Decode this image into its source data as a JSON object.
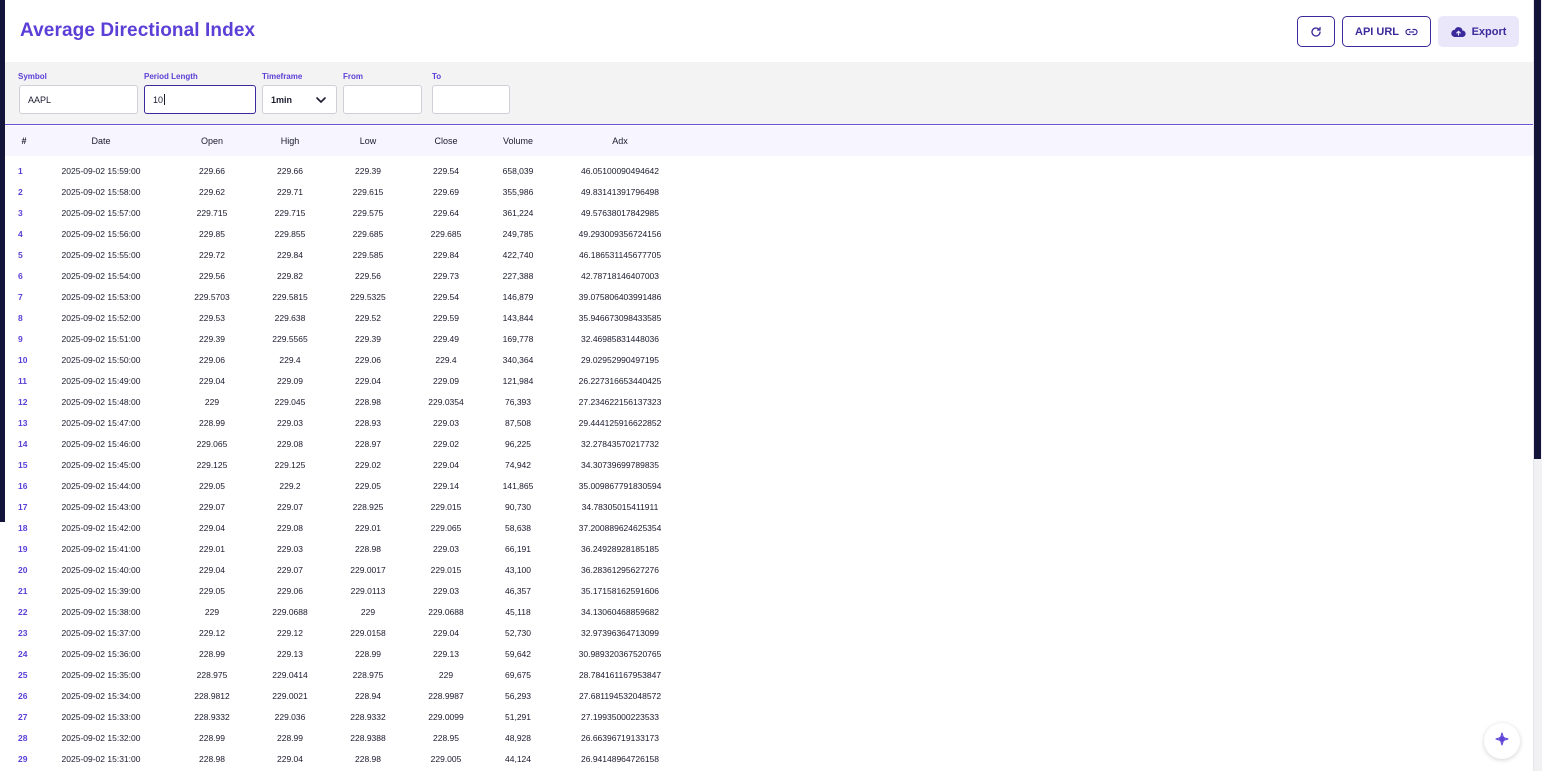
{
  "header": {
    "title": "Average Directional Index",
    "refresh_icon": "refresh-icon",
    "api_url_label": "API URL",
    "api_url_icon": "link-icon",
    "export_label": "Export",
    "export_icon": "cloud-upload-icon"
  },
  "filters": {
    "symbol": {
      "label": "Symbol",
      "value": "AAPL"
    },
    "period_length": {
      "label": "Period Length",
      "value": "10"
    },
    "timeframe": {
      "label": "Timeframe",
      "value": "1min"
    },
    "from": {
      "label": "From",
      "value": ""
    },
    "to": {
      "label": "To",
      "value": ""
    }
  },
  "table": {
    "columns": [
      "#",
      "Date",
      "Open",
      "High",
      "Low",
      "Close",
      "Volume",
      "Adx"
    ],
    "rows": [
      [
        "1",
        "2025-09-02 15:59:00",
        "229.66",
        "229.66",
        "229.39",
        "229.54",
        "658,039",
        "46.05100090494642"
      ],
      [
        "2",
        "2025-09-02 15:58:00",
        "229.62",
        "229.71",
        "229.615",
        "229.69",
        "355,986",
        "49.83141391796498"
      ],
      [
        "3",
        "2025-09-02 15:57:00",
        "229.715",
        "229.715",
        "229.575",
        "229.64",
        "361,224",
        "49.57638017842985"
      ],
      [
        "4",
        "2025-09-02 15:56:00",
        "229.85",
        "229.855",
        "229.685",
        "229.685",
        "249,785",
        "49.293009356724156"
      ],
      [
        "5",
        "2025-09-02 15:55:00",
        "229.72",
        "229.84",
        "229.585",
        "229.84",
        "422,740",
        "46.186531145677705"
      ],
      [
        "6",
        "2025-09-02 15:54:00",
        "229.56",
        "229.82",
        "229.56",
        "229.73",
        "227,388",
        "42.78718146407003"
      ],
      [
        "7",
        "2025-09-02 15:53:00",
        "229.5703",
        "229.5815",
        "229.5325",
        "229.54",
        "146,879",
        "39.075806403991486"
      ],
      [
        "8",
        "2025-09-02 15:52:00",
        "229.53",
        "229.638",
        "229.52",
        "229.59",
        "143,844",
        "35.946673098433585"
      ],
      [
        "9",
        "2025-09-02 15:51:00",
        "229.39",
        "229.5565",
        "229.39",
        "229.49",
        "169,778",
        "32.46985831448036"
      ],
      [
        "10",
        "2025-09-02 15:50:00",
        "229.06",
        "229.4",
        "229.06",
        "229.4",
        "340,364",
        "29.02952990497195"
      ],
      [
        "11",
        "2025-09-02 15:49:00",
        "229.04",
        "229.09",
        "229.04",
        "229.09",
        "121,984",
        "26.227316653440425"
      ],
      [
        "12",
        "2025-09-02 15:48:00",
        "229",
        "229.045",
        "228.98",
        "229.0354",
        "76,393",
        "27.234622156137323"
      ],
      [
        "13",
        "2025-09-02 15:47:00",
        "228.99",
        "229.03",
        "228.93",
        "229.03",
        "87,508",
        "29.444125916622852"
      ],
      [
        "14",
        "2025-09-02 15:46:00",
        "229.065",
        "229.08",
        "228.97",
        "229.02",
        "96,225",
        "32.27843570217732"
      ],
      [
        "15",
        "2025-09-02 15:45:00",
        "229.125",
        "229.125",
        "229.02",
        "229.04",
        "74,942",
        "34.30739699789835"
      ],
      [
        "16",
        "2025-09-02 15:44:00",
        "229.05",
        "229.2",
        "229.05",
        "229.14",
        "141,865",
        "35.009867791830594"
      ],
      [
        "17",
        "2025-09-02 15:43:00",
        "229.07",
        "229.07",
        "228.925",
        "229.015",
        "90,730",
        "34.78305015411911"
      ],
      [
        "18",
        "2025-09-02 15:42:00",
        "229.04",
        "229.08",
        "229.01",
        "229.065",
        "58,638",
        "37.200889624625354"
      ],
      [
        "19",
        "2025-09-02 15:41:00",
        "229.01",
        "229.03",
        "228.98",
        "229.03",
        "66,191",
        "36.24928928185185"
      ],
      [
        "20",
        "2025-09-02 15:40:00",
        "229.04",
        "229.07",
        "229.0017",
        "229.015",
        "43,100",
        "36.28361295627276"
      ],
      [
        "21",
        "2025-09-02 15:39:00",
        "229.05",
        "229.06",
        "229.0113",
        "229.03",
        "46,357",
        "35.17158162591606"
      ],
      [
        "22",
        "2025-09-02 15:38:00",
        "229",
        "229.0688",
        "229",
        "229.0688",
        "45,118",
        "34.13060468859682"
      ],
      [
        "23",
        "2025-09-02 15:37:00",
        "229.12",
        "229.12",
        "229.0158",
        "229.04",
        "52,730",
        "32.97396364713099"
      ],
      [
        "24",
        "2025-09-02 15:36:00",
        "228.99",
        "229.13",
        "228.99",
        "229.13",
        "59,642",
        "30.989320367520765"
      ],
      [
        "25",
        "2025-09-02 15:35:00",
        "228.975",
        "229.0414",
        "228.975",
        "229",
        "69,675",
        "28.784161167953847"
      ],
      [
        "26",
        "2025-09-02 15:34:00",
        "228.9812",
        "229.0021",
        "228.94",
        "228.9987",
        "56,293",
        "27.681194532048572"
      ],
      [
        "27",
        "2025-09-02 15:33:00",
        "228.9332",
        "229.036",
        "228.9332",
        "229.0099",
        "51,291",
        "27.19935000223533"
      ],
      [
        "28",
        "2025-09-02 15:32:00",
        "228.99",
        "228.99",
        "228.9388",
        "228.95",
        "48,928",
        "26.66396719133173"
      ],
      [
        "29",
        "2025-09-02 15:31:00",
        "228.98",
        "229.04",
        "228.98",
        "229.005",
        "44,124",
        "26.94148964726158"
      ]
    ]
  },
  "fab": {
    "icon": "sparkle-icon"
  },
  "colors": {
    "accent": "#5b3fd6",
    "dark": "#14143a",
    "header_bg": "#f7f5ff"
  }
}
